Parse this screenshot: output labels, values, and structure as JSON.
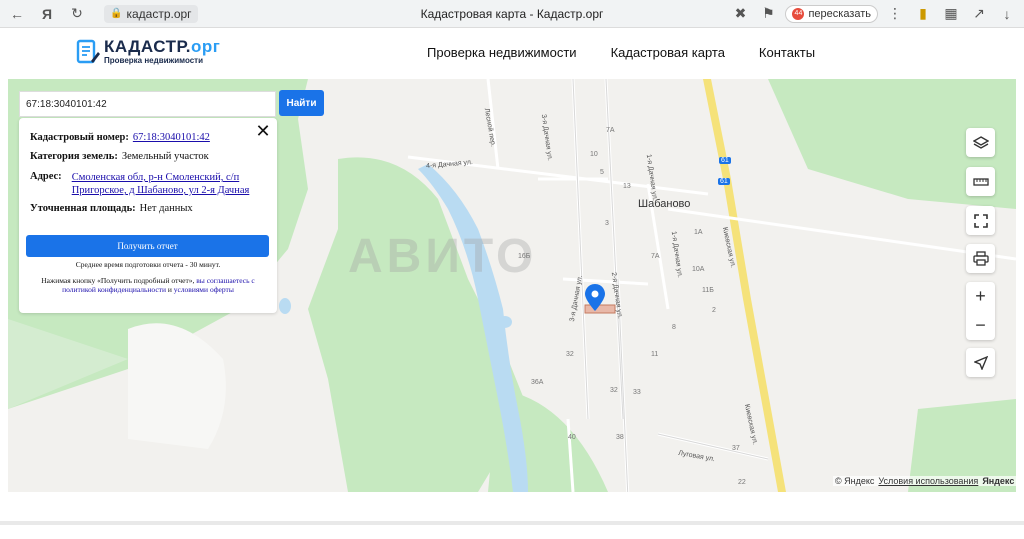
{
  "browser": {
    "url": "кадастр.орг",
    "tab_title": "Кадастровая карта - Кадастр.орг",
    "retell_label": "пересказать",
    "retell_badge": "44"
  },
  "header": {
    "logo_name_main": "КАДАСТР.",
    "logo_name_accent": "орг",
    "logo_tagline": "Проверка недвижимости",
    "nav": [
      "Проверка недвижимости",
      "Кадастровая карта",
      "Контакты"
    ]
  },
  "search": {
    "value": "67:18:3040101:42",
    "button_label": "Найти"
  },
  "info": {
    "cadastral_label": "Кадастровый номер:",
    "cadastral_value": "67:18:3040101:42",
    "category_label": "Категория земель:",
    "category_value": "Земельный участок",
    "address_label": "Адрес:",
    "address_line1": "Смоленская обл, р-н Смоленский, с/п",
    "address_line2": "Пригорское, д Шабаново, ул 2-я Дачная",
    "area_label": "Уточненная площадь:",
    "area_value": "Нет данных",
    "report_button": "Получить отчет",
    "avg_time": "Среднее время подготовки отчета - 30 минут.",
    "notice_prefix": "Нажимая кнопку «Получить подробный отчет», ",
    "notice_link1": "вы соглашаетесь с политикой конфиденциальности",
    "notice_and": " и ",
    "notice_link2": "условиями оферты"
  },
  "map": {
    "place": "Шабаново",
    "streets": {
      "dachnaya4": "4-я Дачная ул.",
      "lesnoy": "Лесной пер.",
      "dachnaya3_top": "3-я Дачная ул.",
      "dachnaya1": "1-я Дачная ул.",
      "kievskaya_top": "Киевская ул.",
      "kievskaya_bottom": "Киевская ул.",
      "dachnaya3_mid": "3-я Дачная ул.",
      "dachnaya2": "2-я Дачная ул.",
      "dachnaya1_mid": "1-я Дачная ул.",
      "lugovaya": "Луговая ул."
    },
    "house_numbers": [
      "7А",
      "10",
      "13",
      "3",
      "1А",
      "7А",
      "10А",
      "11Б",
      "16Б",
      "32",
      "11",
      "36А",
      "33",
      "32",
      "40",
      "38",
      "37",
      "22",
      "2",
      "8",
      "5"
    ],
    "route_badges": [
      "61",
      "61"
    ],
    "watermark": "АВИТО",
    "copyright": "© Яндекс",
    "terms": "Условия использования",
    "brand": "Яндекс"
  },
  "colors": {
    "accent": "#1a73e8",
    "forest": "#c6e9c0",
    "water": "#b9dbf2",
    "highway": "#f5e27a",
    "marker": "#1a73e8"
  }
}
